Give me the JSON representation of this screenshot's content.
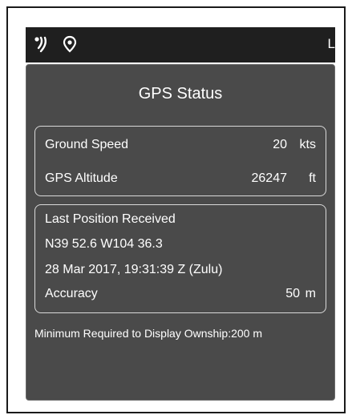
{
  "toolbar": {
    "icons": [
      "radar-signal-icon",
      "location-pin-icon"
    ],
    "edge_letter": "L"
  },
  "gps": {
    "title": "GPS Status",
    "ground_speed": {
      "label": "Ground Speed",
      "value": "20",
      "unit": "kts"
    },
    "altitude": {
      "label": "GPS Altitude",
      "value": "26247",
      "unit": "ft"
    },
    "last_position": {
      "label": "Last Position Received",
      "coordinates": "N39 52.6 W104 36.3",
      "timestamp": "28 Mar 2017, 19:31:39 Z (Zulu)",
      "accuracy_label": "Accuracy",
      "accuracy_value": "50",
      "accuracy_unit": "m"
    },
    "footer": "Minimum Required to Display Ownship:200 m"
  },
  "colors": {
    "panel_bg": "#4a4a4a",
    "toolbar_bg": "#1f1f1f",
    "text": "#ffffff",
    "box_border": "#d9d9d9"
  }
}
